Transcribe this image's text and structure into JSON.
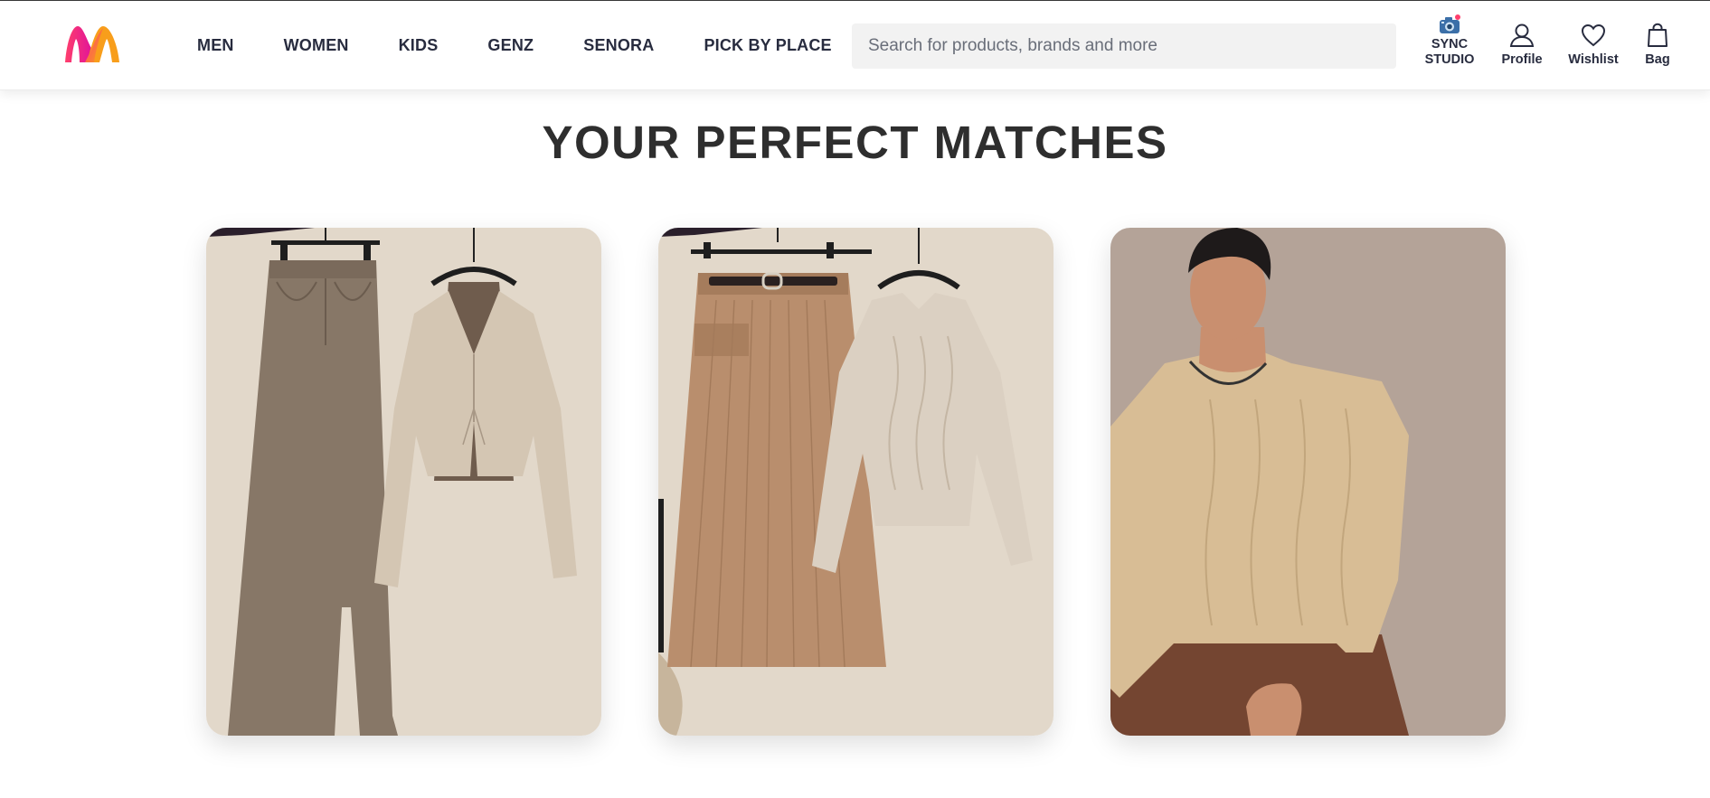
{
  "header": {
    "logo_name": "myntra-logo",
    "nav": [
      "MEN",
      "WOMEN",
      "KIDS",
      "GENZ",
      "SENORA",
      "PICK BY PLACE"
    ],
    "search": {
      "placeholder": "Search for products, brands and more",
      "icon": "search"
    },
    "actions": {
      "sync_studio": {
        "line1": "SYNC",
        "line2": "STUDIO",
        "icon": "camera-icon"
      },
      "profile": {
        "label": "Profile",
        "icon": "user-icon"
      },
      "wishlist": {
        "label": "Wishlist",
        "icon": "heart-icon"
      },
      "bag": {
        "label": "Bag",
        "icon": "bag-icon"
      }
    }
  },
  "main": {
    "title": "YOUR PERFECT MATCHES",
    "cards": [
      {
        "name": "denim-skirt-and-cardigan-set",
        "bg": "#e2d8ca"
      },
      {
        "name": "ribbed-skirt-and-cable-sweater-set",
        "bg": "#e2d8ca"
      },
      {
        "name": "men-cable-knit-sweater",
        "bg": "#b4a398"
      }
    ]
  },
  "colors": {
    "brand_pink": "#ff3f6c",
    "brand_orange": "#f89e1b",
    "text": "#282c3f",
    "search_bg": "#f2f2f2"
  }
}
